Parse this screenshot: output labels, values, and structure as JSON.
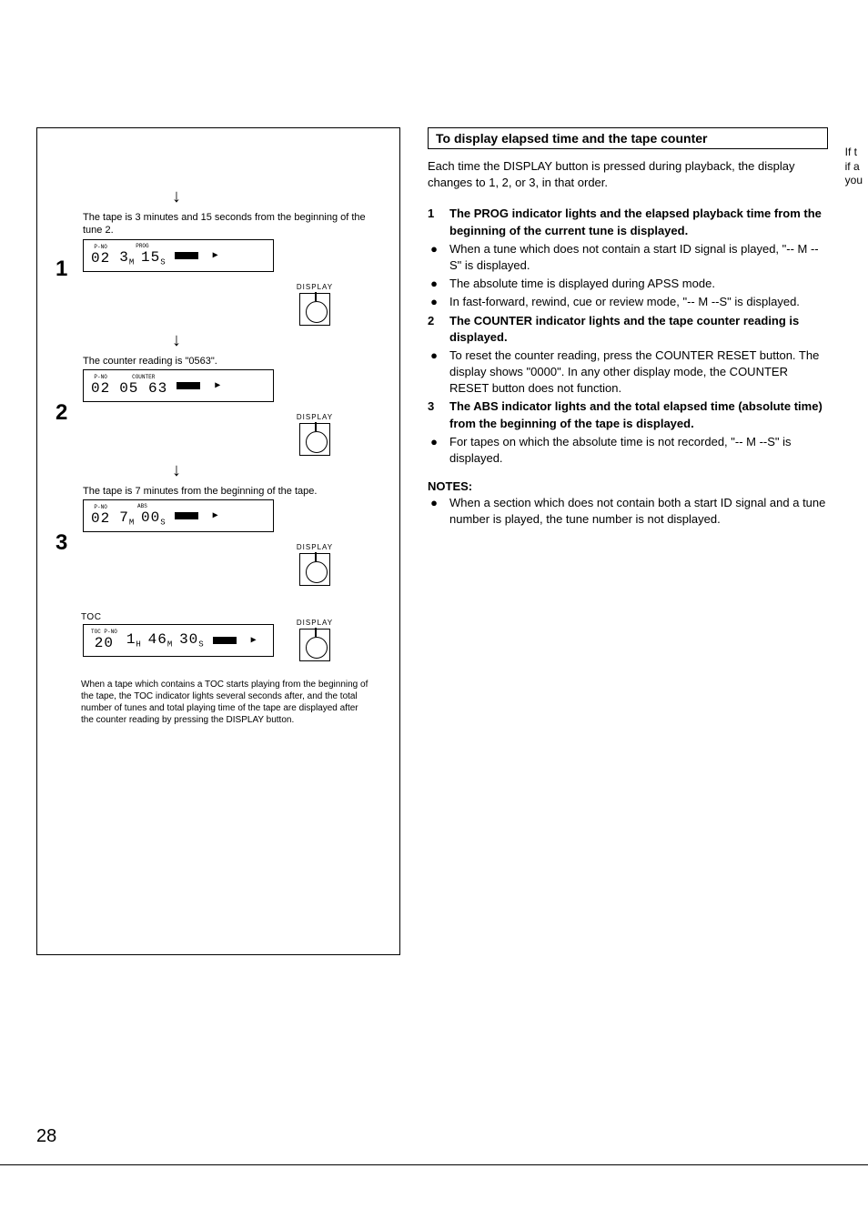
{
  "left": {
    "steps": [
      {
        "num": "1",
        "caption": "The tape is 3 minutes and 15 seconds from the beginning of the tune 2.",
        "lcd": {
          "l1": "P-NO",
          "v1": "02",
          "l2": "PROG",
          "v2": "3",
          "u2": "M",
          "v3": "15",
          "u3": "S"
        },
        "iconLabel": "DISPLAY"
      },
      {
        "num": "2",
        "caption": "The counter reading is \"0563\".",
        "lcd": {
          "l1": "P-NO",
          "v1": "02",
          "l2": "COUNTER",
          "v2": "05 63",
          "u2": "",
          "v3": "",
          "u3": ""
        },
        "iconLabel": "DISPLAY"
      },
      {
        "num": "3",
        "caption": "The tape is 7 minutes from the beginning of the tape.",
        "lcd": {
          "l1": "P-NO",
          "v1": "02",
          "l2": "ABS",
          "v2": "7",
          "u2": "M",
          "v3": "00",
          "u3": "S"
        },
        "iconLabel": "DISPLAY"
      }
    ],
    "toc": {
      "label": "TOC",
      "lcd": {
        "l1": "TOC P-NO",
        "v1": "20",
        "v2": "1",
        "u2": "H",
        "v3": "46",
        "u3": "M",
        "v4": "30",
        "u4": "S"
      },
      "iconLabel": "DISPLAY",
      "caption": "When a tape which contains a TOC starts playing from the beginning of the tape, the TOC indicator lights several seconds after, and the total number of tunes and total playing time of the tape are displayed after the counter reading by pressing the DISPLAY button."
    }
  },
  "right": {
    "header": "To display elapsed time and the tape counter",
    "intro": "Each time the DISPLAY button is pressed during playback, the display changes to 1, 2, or 3, in that order.",
    "items": [
      {
        "num": "1",
        "bold": true,
        "text": "The PROG indicator lights and the elapsed playback time from the beginning of the current tune is displayed."
      },
      {
        "bullet": "●",
        "text": "When a tune which does not contain a start ID signal is played, \"-- M -- S\" is displayed."
      },
      {
        "bullet": "●",
        "text": "The absolute time is displayed during APSS mode."
      },
      {
        "bullet": "●",
        "text": "In fast-forward, rewind, cue or review mode, \"-- M --S\" is displayed."
      },
      {
        "num": "2",
        "bold": true,
        "text": "The COUNTER indicator lights and the tape counter reading is displayed."
      },
      {
        "bullet": "●",
        "text": "To reset the counter reading, press the COUNTER RESET button. The display shows \"0000\". In any other display mode, the COUNTER RESET button does not function."
      },
      {
        "num": "3",
        "bold": true,
        "text": "The ABS indicator lights and the total elapsed time (absolute time) from the beginning of the tape is displayed."
      },
      {
        "bullet": "●",
        "text": "For tapes on which the absolute time is not recorded, \"-- M --S\" is displayed."
      }
    ],
    "notesHead": "NOTES:",
    "notes": [
      {
        "bullet": "●",
        "text": "When a section which does not contain both a start ID signal and a tune number is played, the tune number is not displayed."
      }
    ]
  },
  "edge": {
    "l1": "If t",
    "l2": "if a",
    "l3": "you"
  },
  "pageNum": "28"
}
